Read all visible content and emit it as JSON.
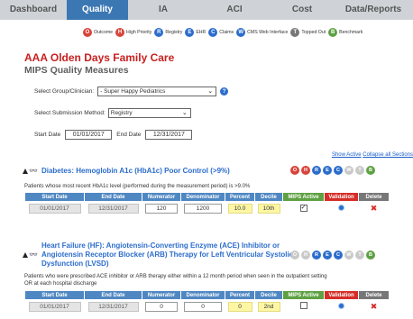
{
  "nav": {
    "tabs": [
      {
        "label": "Dashboard",
        "active": false
      },
      {
        "label": "Quality",
        "active": true
      },
      {
        "label": "IA",
        "active": false
      },
      {
        "label": "ACI",
        "active": false
      },
      {
        "label": "Cost",
        "active": false
      },
      {
        "label": "Data/Reports",
        "active": false
      }
    ]
  },
  "legend": [
    {
      "letter": "O",
      "label": "Outcome",
      "color": "#d9443b"
    },
    {
      "letter": "H",
      "label": "High Priority",
      "color": "#d9443b"
    },
    {
      "letter": "R",
      "label": "Registry",
      "color": "#2c6dcc"
    },
    {
      "letter": "E",
      "label": "EHR",
      "color": "#2c6dcc"
    },
    {
      "letter": "C",
      "label": "Claims",
      "color": "#2c6dcc"
    },
    {
      "letter": "W",
      "label": "CMS Web Interface",
      "color": "#2c6dcc"
    },
    {
      "letter": "T",
      "label": "Topped Out",
      "color": "#777777"
    },
    {
      "letter": "B",
      "label": "Benchmark",
      "color": "#5ea142"
    }
  ],
  "page": {
    "org_name": "AAA Olden Days Family Care",
    "section_title": "MIPS Quality Measures"
  },
  "form": {
    "group_label": "Select Group/Clinician:",
    "group_value": "- Super Happy Pediatrics",
    "help_glyph": "?",
    "method_label": "Select Submission Method:",
    "method_value": "Registry",
    "start_label": "Start Date",
    "start_value": "01/01/2017",
    "end_label": "End Date",
    "end_value": "12/31/2017"
  },
  "links": {
    "show_active": "Show Active",
    "collapse_all": "Collapse all Sections"
  },
  "table_headers": [
    "Start Date",
    "End Date",
    "Numerator",
    "Denominator",
    "Percent",
    "Decile",
    "MIPS Active",
    "Validation",
    "Delete"
  ],
  "measures": [
    {
      "title_lines": [
        "Diabetes: Hemoglobin A1c (HbA1c) Poor Control (>9%)"
      ],
      "badges": [
        {
          "letter": "O",
          "color": "#d9443b"
        },
        {
          "letter": "H",
          "color": "#d9443b"
        },
        {
          "letter": "R",
          "color": "#2c6dcc"
        },
        {
          "letter": "E",
          "color": "#2c6dcc"
        },
        {
          "letter": "C",
          "color": "#2c6dcc"
        },
        {
          "letter": "W",
          "color": "#c9c9c9"
        },
        {
          "letter": "T",
          "color": "#c9c9c9"
        },
        {
          "letter": "B",
          "color": "#5ea142"
        }
      ],
      "desc_lines": [
        "Patients whose most recent HbA1c level (performed during the measurement period) is >9.0%"
      ],
      "row": {
        "start": "01/01/2017",
        "end": "12/31/2017",
        "numerator": "120",
        "denominator": "1200",
        "percent": "10.0",
        "decile": "10th",
        "mips_active": true
      }
    },
    {
      "title_lines": [
        "Heart Failure (HF): Angiotensin-Converting Enzyme (ACE) Inhibitor or",
        "Angiotensin Receptor Blocker (ARB) Therapy for Left Ventricular Systolic",
        "Dysfunction (LVSD)"
      ],
      "badges": [
        {
          "letter": "O",
          "color": "#c9c9c9"
        },
        {
          "letter": "H",
          "color": "#c9c9c9"
        },
        {
          "letter": "R",
          "color": "#2c6dcc"
        },
        {
          "letter": "E",
          "color": "#2c6dcc"
        },
        {
          "letter": "C",
          "color": "#2c6dcc"
        },
        {
          "letter": "W",
          "color": "#c9c9c9"
        },
        {
          "letter": "T",
          "color": "#c9c9c9"
        },
        {
          "letter": "B",
          "color": "#5ea142"
        }
      ],
      "desc_lines": [
        "Patients who were prescribed ACE inhibitor or ARB therapy either within a 12 month period when seen in the outpatient setting",
        "OR at each hospital discharge"
      ],
      "row": {
        "start": "01/01/2017",
        "end": "12/31/2017",
        "numerator": "0",
        "denominator": "0",
        "percent": "0",
        "decile": "2nd",
        "mips_active": false
      }
    }
  ]
}
